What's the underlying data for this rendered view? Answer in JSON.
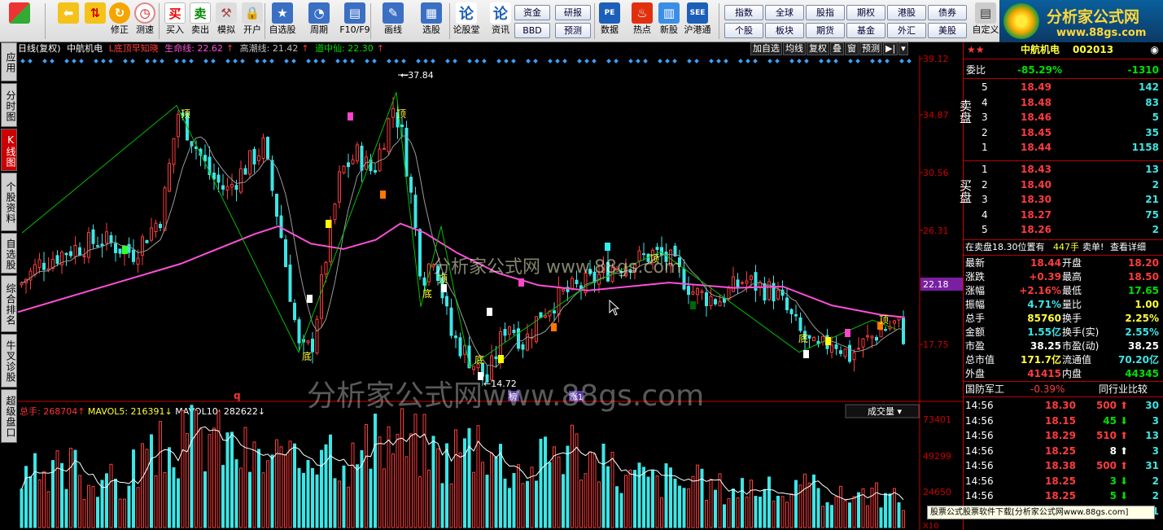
{
  "toolbar": {
    "buttons": [
      {
        "label": "",
        "icon": "grid-icon"
      },
      {
        "label": "",
        "icon": "back-arrow-icon"
      },
      {
        "label": "",
        "icon": "up-down-arrows-icon"
      },
      {
        "label": "修正",
        "icon": "refresh-icon"
      },
      {
        "label": "测速",
        "icon": "clock-icon"
      },
      {
        "label": "买入",
        "icon": "buy-icon",
        "glyph": "买"
      },
      {
        "label": "卖出",
        "icon": "sell-icon",
        "glyph": "卖"
      },
      {
        "label": "模拟",
        "icon": "hammer-icon"
      },
      {
        "label": "开户",
        "icon": "lock-icon"
      },
      {
        "label": "自选股",
        "icon": "star-icon"
      },
      {
        "label": "周期",
        "icon": "cycle-icon"
      },
      {
        "label": "F10/F9",
        "icon": "f10-icon"
      },
      {
        "label": "画线",
        "icon": "pen-icon"
      },
      {
        "label": "选股",
        "icon": "select-icon"
      },
      {
        "label": "论股堂",
        "icon": "forum-icon"
      },
      {
        "label": "数据",
        "icon": "data-icon"
      },
      {
        "label": "热点",
        "icon": "hot-icon"
      },
      {
        "label": "新股",
        "icon": "new-stock-icon"
      },
      {
        "label": "沪港通",
        "icon": "hk-icon"
      },
      {
        "label": "自定义",
        "icon": "custom-icon"
      }
    ],
    "small_buttons_col1": [
      "资金",
      "BBD"
    ],
    "small_buttons_col2": [
      "研报",
      "预测"
    ],
    "info_label": "资讯",
    "info_glyph": "论",
    "right_grid_row1": [
      "指数",
      "全球",
      "股指",
      "期权",
      "港股",
      "债券"
    ],
    "right_grid_row2": [
      "个股",
      "板块",
      "期货",
      "基金",
      "外汇",
      "美股"
    ]
  },
  "logo": {
    "title": "分析家公式网",
    "url": "www.88gs.com"
  },
  "left_tabs": [
    {
      "label": "应用",
      "active": false
    },
    {
      "label": "分时图",
      "active": false
    },
    {
      "label": "K线图",
      "active": true
    },
    {
      "label": "个股资料",
      "active": false
    },
    {
      "label": "自选股",
      "active": false
    },
    {
      "label": "综合排名",
      "active": false
    },
    {
      "label": "牛叉诊股",
      "active": false
    },
    {
      "label": "超级盘口",
      "active": false
    }
  ],
  "chart_header": {
    "period": "日线(复权)",
    "stock": "中航机电",
    "indicator": "L底顶早知晓",
    "line1": "生命线: 22.62",
    "line2": "高潮线: 21.42",
    "line3": "道中仙: 22.30",
    "tools": [
      "加自选",
      "均线",
      "复权",
      "叠",
      "窗",
      "预测"
    ]
  },
  "price_axis": [
    "39.12",
    "34.87",
    "30.56",
    "26.31",
    "22.18",
    "17.75"
  ],
  "price_marker": "22.18",
  "annotations": {
    "high": "37.84",
    "low": "14.72",
    "top_label": "顶",
    "bottom_label": "底",
    "q_label": "q",
    "bang_label": "榜",
    "zhang_label": "涨1"
  },
  "watermark": "分析家公式网www.88gs.com",
  "volume": {
    "label": "总手: 268704",
    "ma5": "MAVOL5: 216391",
    "ma10": "MAVOL10: 282622",
    "dropdown": "成交量",
    "axis": [
      "73401",
      "49299",
      "24650"
    ],
    "unit": "X10"
  },
  "colors": {
    "up": "#ff3c3c",
    "down": "#3ce6e6",
    "ma": "#ff4fd8",
    "zigzag": "#00c000"
  },
  "chart_data": {
    "type": "candlestick",
    "title": "中航机电 日线(复权)",
    "ylim": [
      14.0,
      39.5
    ],
    "price_path": [
      [
        0,
        22.6
      ],
      [
        25,
        24.2
      ],
      [
        60,
        25.2
      ],
      [
        100,
        26.0
      ],
      [
        140,
        25.0
      ],
      [
        175,
        27.8
      ],
      [
        195,
        35.5
      ],
      [
        210,
        33.8
      ],
      [
        235,
        30.8
      ],
      [
        255,
        29.6
      ],
      [
        275,
        31.2
      ],
      [
        300,
        33.0
      ],
      [
        320,
        27.0
      ],
      [
        345,
        17.5
      ],
      [
        360,
        18.1
      ],
      [
        375,
        24.0
      ],
      [
        395,
        31.0
      ],
      [
        415,
        32.4
      ],
      [
        435,
        31.0
      ],
      [
        460,
        36.0
      ],
      [
        470,
        34.0
      ],
      [
        480,
        30.0
      ],
      [
        495,
        23.0
      ],
      [
        510,
        25.0
      ],
      [
        530,
        19.0
      ],
      [
        555,
        17.0
      ],
      [
        575,
        15.5
      ],
      [
        600,
        20.0
      ],
      [
        620,
        18.2
      ],
      [
        640,
        20.5
      ],
      [
        670,
        22.0
      ],
      [
        700,
        22.8
      ],
      [
        730,
        24.0
      ],
      [
        760,
        24.5
      ],
      [
        780,
        25.0
      ],
      [
        800,
        24.4
      ],
      [
        830,
        22.0
      ],
      [
        860,
        21.5
      ],
      [
        890,
        23.0
      ],
      [
        930,
        22.0
      ],
      [
        960,
        19.0
      ],
      [
        980,
        17.6
      ],
      [
        1000,
        18.6
      ],
      [
        1020,
        17.3
      ],
      [
        1040,
        18.4
      ],
      [
        1060,
        19.3
      ],
      [
        1080,
        19.8
      ],
      [
        1090,
        18.4
      ]
    ],
    "ma_line": [
      [
        0,
        20.6
      ],
      [
        100,
        22.4
      ],
      [
        200,
        24.2
      ],
      [
        290,
        26.4
      ],
      [
        320,
        27.0
      ],
      [
        360,
        25.7
      ],
      [
        400,
        25.3
      ],
      [
        440,
        26.0
      ],
      [
        470,
        27.2
      ],
      [
        500,
        26.5
      ],
      [
        540,
        25.0
      ],
      [
        590,
        23.5
      ],
      [
        640,
        22.6
      ],
      [
        700,
        22.2
      ],
      [
        800,
        22.8
      ],
      [
        880,
        22.4
      ],
      [
        940,
        22.5
      ],
      [
        1000,
        21.1
      ],
      [
        1060,
        20.4
      ],
      [
        1090,
        20.2
      ]
    ],
    "zigzag": [
      [
        5,
        26.5
      ],
      [
        195,
        36.0
      ],
      [
        345,
        17.6
      ],
      [
        465,
        37.0
      ],
      [
        495,
        21.0
      ],
      [
        520,
        27.0
      ],
      [
        555,
        16.5
      ],
      [
        700,
        22.6
      ],
      [
        790,
        25.1
      ],
      [
        960,
        17.6
      ],
      [
        1050,
        20.0
      ],
      [
        1080,
        19.3
      ]
    ],
    "volume_values": [
      32,
      38,
      29,
      41,
      35,
      44,
      30,
      36,
      40,
      33,
      28,
      45,
      52,
      48,
      55,
      58,
      60,
      66,
      63,
      70,
      62,
      57,
      54,
      50,
      48,
      52,
      47,
      44,
      46,
      58,
      73,
      60,
      55,
      49,
      52,
      57,
      61,
      64,
      66,
      59,
      60,
      55,
      52,
      50,
      58,
      62,
      67,
      60,
      51,
      45,
      44,
      40,
      47,
      53,
      57,
      61,
      56,
      51,
      48,
      43,
      38,
      35,
      37,
      36,
      33,
      35,
      33,
      30,
      32,
      31,
      29,
      27,
      28,
      30,
      31,
      26,
      25,
      24,
      26,
      27,
      29,
      25,
      23,
      22,
      24,
      26,
      23,
      22,
      21,
      20
    ]
  },
  "quote": {
    "stock_name": "中航机电",
    "code": "002013",
    "weibi_label": "委比",
    "weibi_pct": "-85.29%",
    "weibi_diff": "-1310",
    "sell_label": "卖盘",
    "buy_label": "买盘",
    "sell": [
      {
        "lvl": "5",
        "price": "18.49",
        "vol": "142"
      },
      {
        "lvl": "4",
        "price": "18.48",
        "vol": "83"
      },
      {
        "lvl": "3",
        "price": "18.46",
        "vol": "5"
      },
      {
        "lvl": "2",
        "price": "18.45",
        "vol": "35"
      },
      {
        "lvl": "1",
        "price": "18.44",
        "vol": "1158"
      }
    ],
    "buy": [
      {
        "lvl": "1",
        "price": "18.43",
        "vol": "13"
      },
      {
        "lvl": "2",
        "price": "18.40",
        "vol": "2"
      },
      {
        "lvl": "3",
        "price": "18.30",
        "vol": "21"
      },
      {
        "lvl": "4",
        "price": "18.27",
        "vol": "75"
      },
      {
        "lvl": "5",
        "price": "18.26",
        "vol": "2"
      }
    ],
    "notice": "在卖盘18.30位置有",
    "notice_vol": "447手",
    "notice_action": "卖单!",
    "notice_link": "查看详细",
    "stats": [
      [
        "最新",
        "18.44",
        "开盘",
        "18.20"
      ],
      [
        "涨跌",
        "+0.39",
        "最高",
        "18.50"
      ],
      [
        "涨幅",
        "+2.16%",
        "最低",
        "17.65"
      ],
      [
        "振幅",
        "4.71%",
        "量比",
        "1.00"
      ],
      [
        "总手",
        "85760",
        "换手",
        "2.25%"
      ],
      [
        "金额",
        "1.55亿",
        "换手(实)",
        "2.55%"
      ],
      [
        "市盈",
        "38.25",
        "市盈(动)",
        "38.25"
      ],
      [
        "总市值",
        "171.7亿",
        "流通值",
        "70.20亿"
      ],
      [
        "外盘",
        "41415",
        "内盘",
        "44345"
      ]
    ],
    "industry": "国防军工",
    "industry_pct": "-0.39%",
    "industry_compare": "同行业比较",
    "ticks": [
      {
        "time": "14:56",
        "price": "18.30",
        "vol": "500",
        "dir": "up",
        "n": "30"
      },
      {
        "time": "14:56",
        "price": "18.15",
        "vol": "45",
        "dir": "down",
        "n": "3"
      },
      {
        "time": "14:56",
        "price": "18.29",
        "vol": "510",
        "dir": "up",
        "n": "13"
      },
      {
        "time": "14:56",
        "price": "18.25",
        "vol": "8",
        "dir": "up-w",
        "n": "3"
      },
      {
        "time": "14:56",
        "price": "18.38",
        "vol": "500",
        "dir": "up",
        "n": "31"
      },
      {
        "time": "14:56",
        "price": "18.25",
        "vol": "3",
        "dir": "down",
        "n": "2"
      },
      {
        "time": "14:56",
        "price": "18.25",
        "vol": "5",
        "dir": "down",
        "n": "2"
      },
      {
        "time": "14:56",
        "price": "18.27",
        "vol": "35",
        "dir": "up",
        "n": "1"
      }
    ]
  },
  "tooltip": "股票公式股票软件下载[分析家公式网www.88gs.com]"
}
